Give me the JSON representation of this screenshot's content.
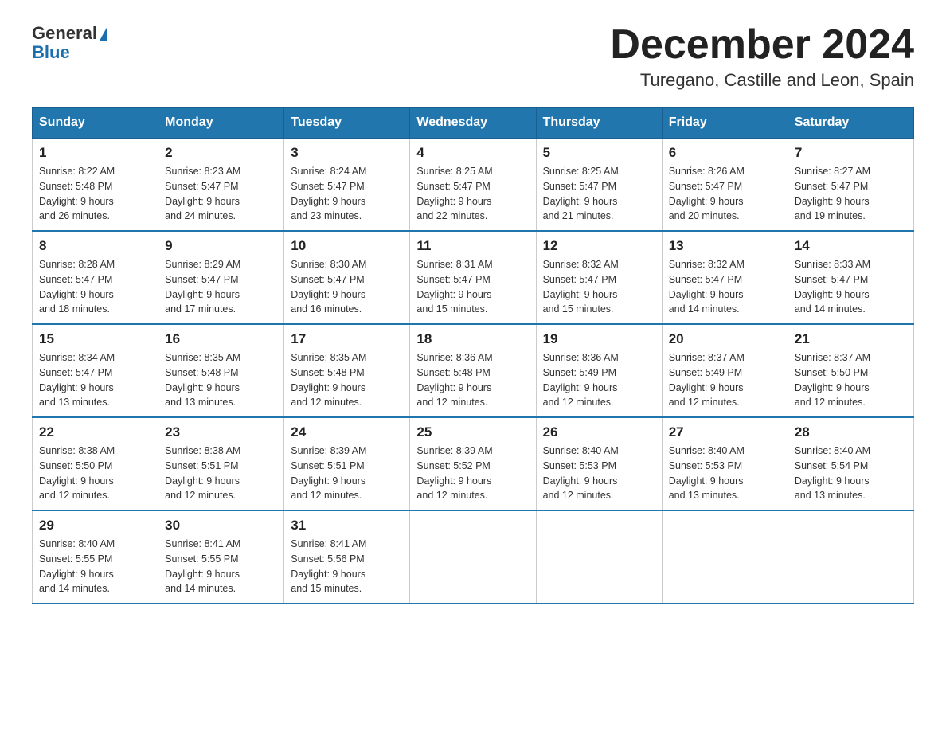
{
  "header": {
    "logo_general": "General",
    "logo_blue": "Blue",
    "month_title": "December 2024",
    "location": "Turegano, Castille and Leon, Spain"
  },
  "days_of_week": [
    "Sunday",
    "Monday",
    "Tuesday",
    "Wednesday",
    "Thursday",
    "Friday",
    "Saturday"
  ],
  "weeks": [
    [
      {
        "day": "1",
        "sunrise": "8:22 AM",
        "sunset": "5:48 PM",
        "daylight": "9 hours and 26 minutes."
      },
      {
        "day": "2",
        "sunrise": "8:23 AM",
        "sunset": "5:47 PM",
        "daylight": "9 hours and 24 minutes."
      },
      {
        "day": "3",
        "sunrise": "8:24 AM",
        "sunset": "5:47 PM",
        "daylight": "9 hours and 23 minutes."
      },
      {
        "day": "4",
        "sunrise": "8:25 AM",
        "sunset": "5:47 PM",
        "daylight": "9 hours and 22 minutes."
      },
      {
        "day": "5",
        "sunrise": "8:25 AM",
        "sunset": "5:47 PM",
        "daylight": "9 hours and 21 minutes."
      },
      {
        "day": "6",
        "sunrise": "8:26 AM",
        "sunset": "5:47 PM",
        "daylight": "9 hours and 20 minutes."
      },
      {
        "day": "7",
        "sunrise": "8:27 AM",
        "sunset": "5:47 PM",
        "daylight": "9 hours and 19 minutes."
      }
    ],
    [
      {
        "day": "8",
        "sunrise": "8:28 AM",
        "sunset": "5:47 PM",
        "daylight": "9 hours and 18 minutes."
      },
      {
        "day": "9",
        "sunrise": "8:29 AM",
        "sunset": "5:47 PM",
        "daylight": "9 hours and 17 minutes."
      },
      {
        "day": "10",
        "sunrise": "8:30 AM",
        "sunset": "5:47 PM",
        "daylight": "9 hours and 16 minutes."
      },
      {
        "day": "11",
        "sunrise": "8:31 AM",
        "sunset": "5:47 PM",
        "daylight": "9 hours and 15 minutes."
      },
      {
        "day": "12",
        "sunrise": "8:32 AM",
        "sunset": "5:47 PM",
        "daylight": "9 hours and 15 minutes."
      },
      {
        "day": "13",
        "sunrise": "8:32 AM",
        "sunset": "5:47 PM",
        "daylight": "9 hours and 14 minutes."
      },
      {
        "day": "14",
        "sunrise": "8:33 AM",
        "sunset": "5:47 PM",
        "daylight": "9 hours and 14 minutes."
      }
    ],
    [
      {
        "day": "15",
        "sunrise": "8:34 AM",
        "sunset": "5:47 PM",
        "daylight": "9 hours and 13 minutes."
      },
      {
        "day": "16",
        "sunrise": "8:35 AM",
        "sunset": "5:48 PM",
        "daylight": "9 hours and 13 minutes."
      },
      {
        "day": "17",
        "sunrise": "8:35 AM",
        "sunset": "5:48 PM",
        "daylight": "9 hours and 12 minutes."
      },
      {
        "day": "18",
        "sunrise": "8:36 AM",
        "sunset": "5:48 PM",
        "daylight": "9 hours and 12 minutes."
      },
      {
        "day": "19",
        "sunrise": "8:36 AM",
        "sunset": "5:49 PM",
        "daylight": "9 hours and 12 minutes."
      },
      {
        "day": "20",
        "sunrise": "8:37 AM",
        "sunset": "5:49 PM",
        "daylight": "9 hours and 12 minutes."
      },
      {
        "day": "21",
        "sunrise": "8:37 AM",
        "sunset": "5:50 PM",
        "daylight": "9 hours and 12 minutes."
      }
    ],
    [
      {
        "day": "22",
        "sunrise": "8:38 AM",
        "sunset": "5:50 PM",
        "daylight": "9 hours and 12 minutes."
      },
      {
        "day": "23",
        "sunrise": "8:38 AM",
        "sunset": "5:51 PM",
        "daylight": "9 hours and 12 minutes."
      },
      {
        "day": "24",
        "sunrise": "8:39 AM",
        "sunset": "5:51 PM",
        "daylight": "9 hours and 12 minutes."
      },
      {
        "day": "25",
        "sunrise": "8:39 AM",
        "sunset": "5:52 PM",
        "daylight": "9 hours and 12 minutes."
      },
      {
        "day": "26",
        "sunrise": "8:40 AM",
        "sunset": "5:53 PM",
        "daylight": "9 hours and 12 minutes."
      },
      {
        "day": "27",
        "sunrise": "8:40 AM",
        "sunset": "5:53 PM",
        "daylight": "9 hours and 13 minutes."
      },
      {
        "day": "28",
        "sunrise": "8:40 AM",
        "sunset": "5:54 PM",
        "daylight": "9 hours and 13 minutes."
      }
    ],
    [
      {
        "day": "29",
        "sunrise": "8:40 AM",
        "sunset": "5:55 PM",
        "daylight": "9 hours and 14 minutes."
      },
      {
        "day": "30",
        "sunrise": "8:41 AM",
        "sunset": "5:55 PM",
        "daylight": "9 hours and 14 minutes."
      },
      {
        "day": "31",
        "sunrise": "8:41 AM",
        "sunset": "5:56 PM",
        "daylight": "9 hours and 15 minutes."
      },
      null,
      null,
      null,
      null
    ]
  ],
  "labels": {
    "sunrise": "Sunrise:",
    "sunset": "Sunset:",
    "daylight": "Daylight:"
  }
}
